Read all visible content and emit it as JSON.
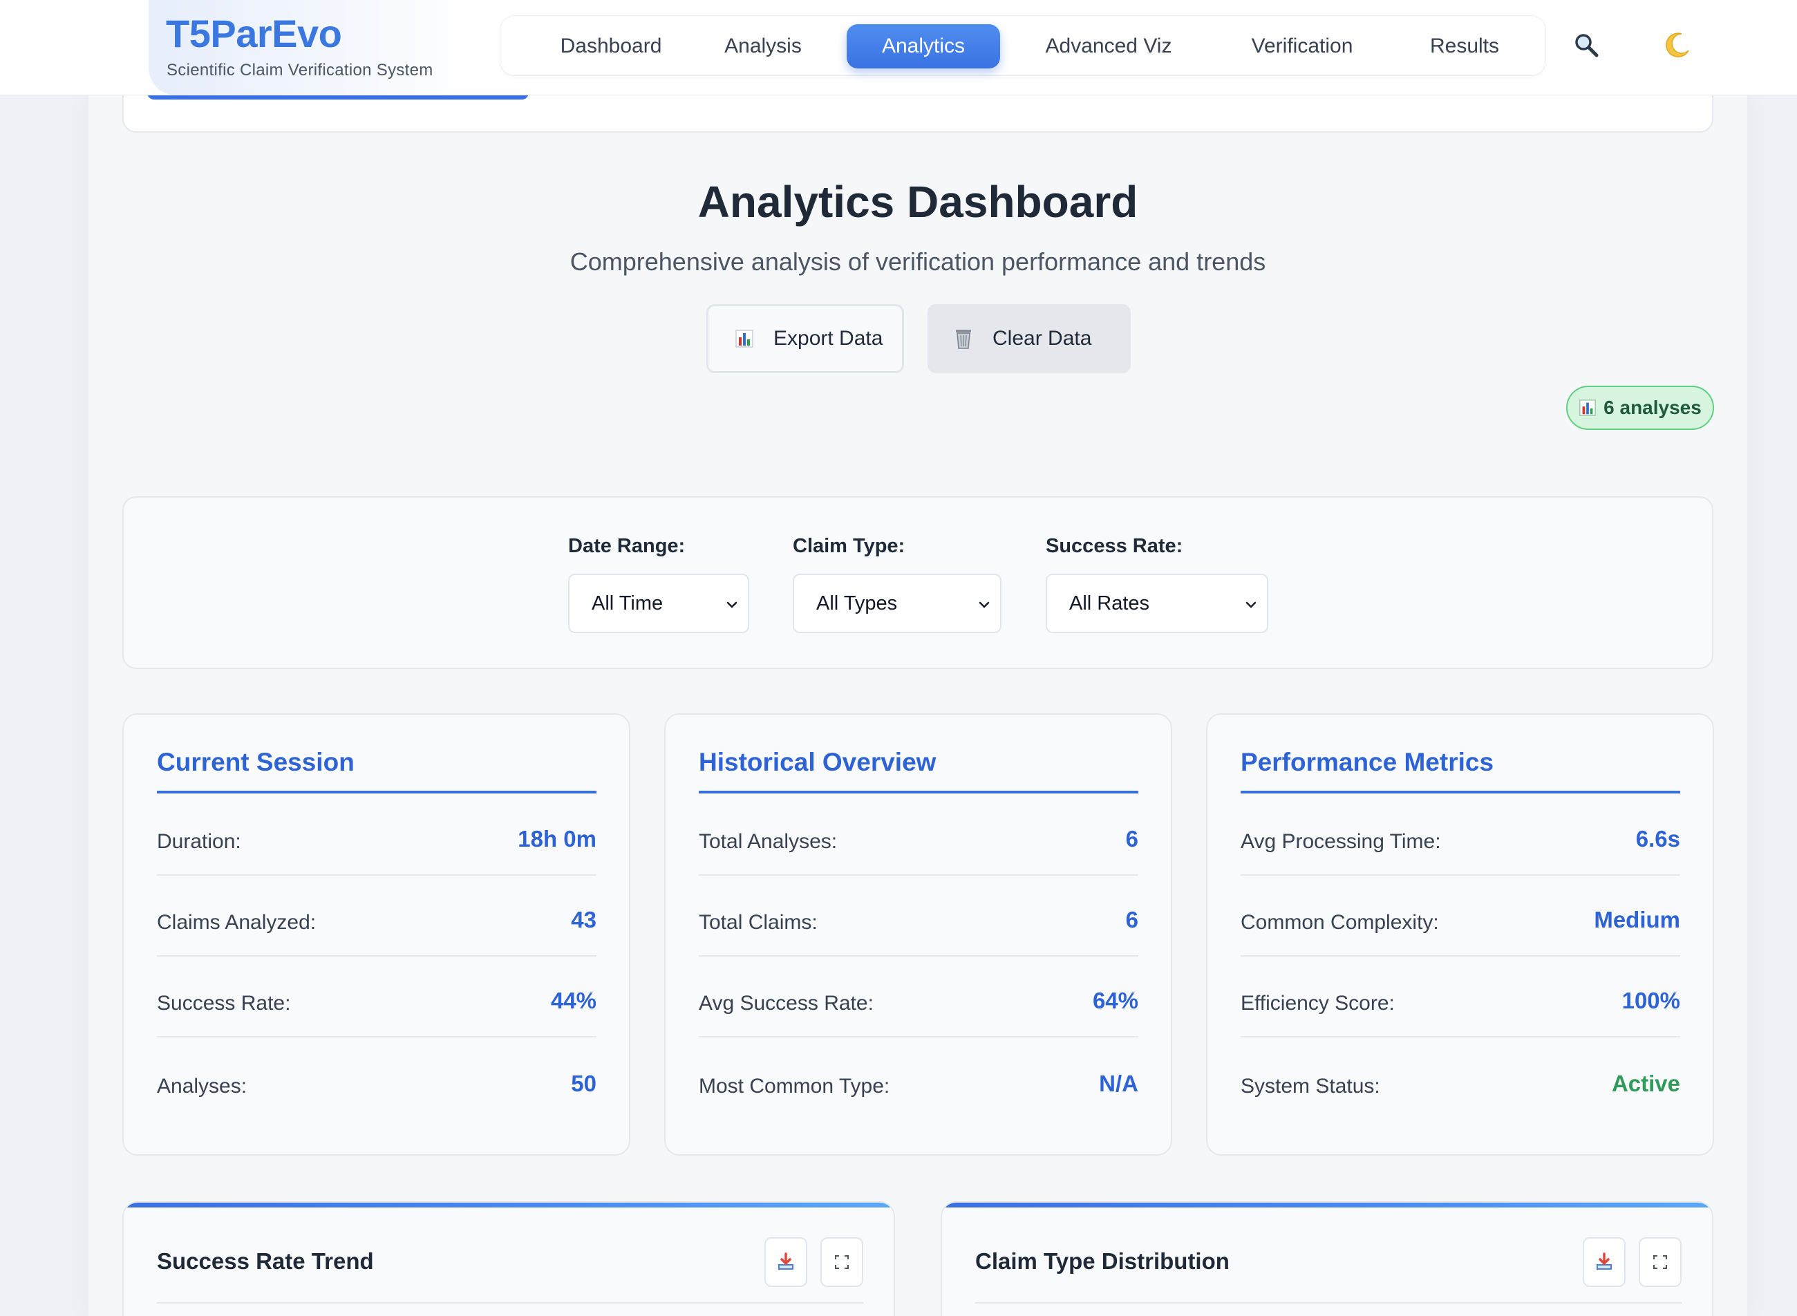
{
  "brand": {
    "title": "T5ParEvo",
    "subtitle": "Scientific Claim Verification System"
  },
  "nav": {
    "items": [
      {
        "label": "Dashboard",
        "active": false
      },
      {
        "label": "Analysis",
        "active": false
      },
      {
        "label": "Analytics",
        "active": true
      },
      {
        "label": "Advanced Viz",
        "active": false
      },
      {
        "label": "Verification",
        "active": false
      },
      {
        "label": "Results",
        "active": false
      }
    ],
    "search_icon": "search-icon",
    "theme_icon": "moon-icon"
  },
  "header": {
    "title": "Analytics Dashboard",
    "subtitle": "Comprehensive analysis of verification performance and trends",
    "export_label": "Export Data",
    "clear_label": "Clear Data",
    "badge": "6 analyses"
  },
  "filters": {
    "date_range": {
      "label": "Date Range:",
      "value": "All Time"
    },
    "claim_type": {
      "label": "Claim Type:",
      "value": "All Types"
    },
    "success_rate": {
      "label": "Success Rate:",
      "value": "All Rates"
    }
  },
  "cards": [
    {
      "title": "Current Session",
      "rows": [
        {
          "key": "Duration:",
          "value": "18h 0m"
        },
        {
          "key": "Claims Analyzed:",
          "value": "43"
        },
        {
          "key": "Success Rate:",
          "value": "44%"
        },
        {
          "key": "Analyses:",
          "value": "50"
        }
      ]
    },
    {
      "title": "Historical Overview",
      "rows": [
        {
          "key": "Total Analyses:",
          "value": "6"
        },
        {
          "key": "Total Claims:",
          "value": "6"
        },
        {
          "key": "Avg Success Rate:",
          "value": "64%"
        },
        {
          "key": "Most Common Type:",
          "value": "N/A"
        }
      ]
    },
    {
      "title": "Performance Metrics",
      "rows": [
        {
          "key": "Avg Processing Time:",
          "value": "6.6s"
        },
        {
          "key": "Common Complexity:",
          "value": "Medium"
        },
        {
          "key": "Efficiency Score:",
          "value": "100%"
        },
        {
          "key": "System Status:",
          "value": "Active"
        }
      ]
    }
  ],
  "charts": [
    {
      "title": "Success Rate Trend"
    },
    {
      "title": "Claim Type Distribution"
    }
  ],
  "colors": {
    "accent": "#3a72e2",
    "value_blue": "#2e63d6",
    "status_green": "#2f9a5a",
    "badge_bg": "#d7f5de"
  }
}
